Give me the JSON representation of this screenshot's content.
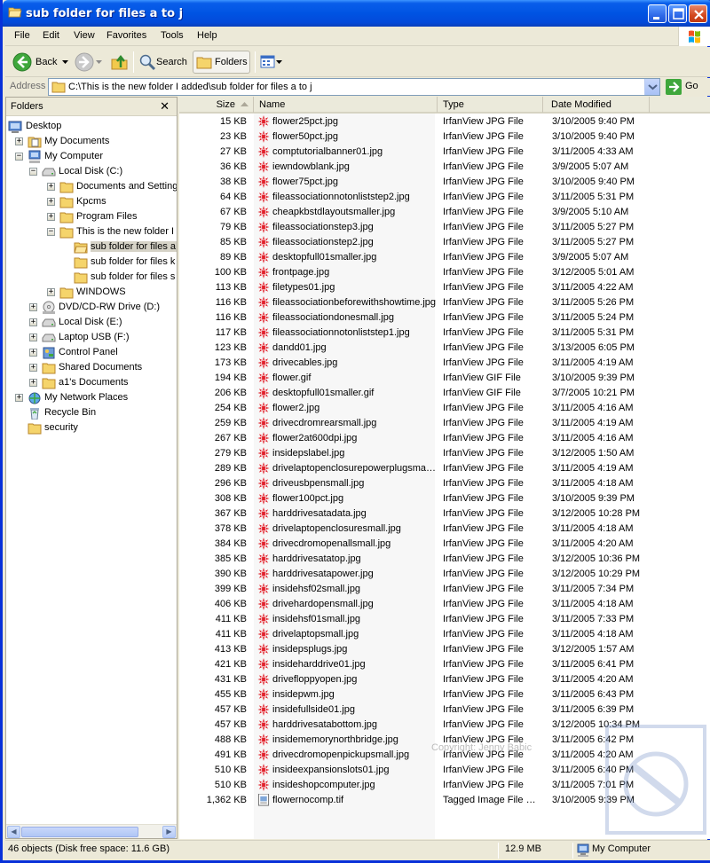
{
  "window": {
    "title": "sub folder for files a to j"
  },
  "menu": [
    {
      "label": "File",
      "u": "F",
      "rest": "ile"
    },
    {
      "label": "Edit",
      "u": "E",
      "rest": "dit"
    },
    {
      "label": "View",
      "u": "V",
      "rest": "iew"
    },
    {
      "label": "Favorites",
      "u": "a",
      "pre": "F",
      "rest": "vorites"
    },
    {
      "label": "Tools",
      "u": "T",
      "rest": "ools"
    },
    {
      "label": "Help",
      "u": "H",
      "rest": "elp"
    }
  ],
  "toolbar": {
    "back": "Back",
    "search": "Search",
    "folders": "Folders"
  },
  "address": {
    "label": "Address",
    "path": "C:\\This is the new folder I added\\sub folder for files a to j",
    "go": "Go"
  },
  "folders_pane": {
    "title": "Folders",
    "tree": [
      {
        "label": "Desktop",
        "level": 0,
        "exp": "",
        "icon": "desktop-icon"
      },
      {
        "label": "My Documents",
        "level": 1,
        "exp": "+",
        "icon": "my-documents-icon"
      },
      {
        "label": "My Computer",
        "level": 1,
        "exp": "−",
        "icon": "my-computer-icon"
      },
      {
        "label": "Local Disk (C:)",
        "level": 2,
        "exp": "−",
        "icon": "local-disk-icon"
      },
      {
        "label": "Documents and Settings",
        "level": 3,
        "exp": "+",
        "icon": "folder-icon"
      },
      {
        "label": "Kpcms",
        "level": 3,
        "exp": "+",
        "icon": "folder-icon"
      },
      {
        "label": "Program Files",
        "level": 3,
        "exp": "+",
        "icon": "folder-icon"
      },
      {
        "label": "This is the new folder I added",
        "level": 3,
        "exp": "−",
        "icon": "folder-icon"
      },
      {
        "label": "sub folder for files a to j",
        "level": 4,
        "exp": "",
        "icon": "open-folder-icon",
        "selected": true
      },
      {
        "label": "sub folder for files k to r",
        "level": 4,
        "exp": "",
        "icon": "folder-icon"
      },
      {
        "label": "sub folder for files s to z",
        "level": 4,
        "exp": "",
        "icon": "folder-icon"
      },
      {
        "label": "WINDOWS",
        "level": 3,
        "exp": "+",
        "icon": "folder-icon"
      },
      {
        "label": "DVD/CD-RW Drive (D:)",
        "level": 2,
        "exp": "+",
        "icon": "cd-drive-icon"
      },
      {
        "label": "Local Disk (E:)",
        "level": 2,
        "exp": "+",
        "icon": "local-disk-icon"
      },
      {
        "label": "Laptop USB (F:)",
        "level": 2,
        "exp": "+",
        "icon": "local-disk-icon"
      },
      {
        "label": "Control Panel",
        "level": 2,
        "exp": "+",
        "icon": "control-panel-icon"
      },
      {
        "label": "Shared Documents",
        "level": 2,
        "exp": "+",
        "icon": "folder-icon"
      },
      {
        "label": "a1's Documents",
        "level": 2,
        "exp": "+",
        "icon": "folder-icon"
      },
      {
        "label": "My Network Places",
        "level": 1,
        "exp": "+",
        "icon": "network-places-icon"
      },
      {
        "label": "Recycle Bin",
        "level": 1,
        "exp": "",
        "icon": "recycle-bin-icon"
      },
      {
        "label": "security",
        "level": 1,
        "exp": "",
        "icon": "folder-icon"
      }
    ]
  },
  "columns": {
    "size": "Size",
    "name": "Name",
    "type": "Type",
    "date": "Date Modified"
  },
  "files": [
    {
      "size": "15 KB",
      "name": "flower25pct.jpg",
      "type": "IrfanView JPG File",
      "date": "3/10/2005 9:40 PM"
    },
    {
      "size": "23 KB",
      "name": "flower50pct.jpg",
      "type": "IrfanView JPG File",
      "date": "3/10/2005 9:40 PM"
    },
    {
      "size": "27 KB",
      "name": "comptutorialbanner01.jpg",
      "type": "IrfanView JPG File",
      "date": "3/11/2005 4:33 AM"
    },
    {
      "size": "36 KB",
      "name": "iewndowblank.jpg",
      "type": "IrfanView JPG File",
      "date": "3/9/2005 5:07 AM"
    },
    {
      "size": "38 KB",
      "name": "flower75pct.jpg",
      "type": "IrfanView JPG File",
      "date": "3/10/2005 9:40 PM"
    },
    {
      "size": "64 KB",
      "name": "fileassociationnotonliststep2.jpg",
      "type": "IrfanView JPG File",
      "date": "3/11/2005 5:31 PM"
    },
    {
      "size": "67 KB",
      "name": "cheapkbstdlayoutsmaller.jpg",
      "type": "IrfanView JPG File",
      "date": "3/9/2005 5:10 AM"
    },
    {
      "size": "79 KB",
      "name": "fileassociationstep3.jpg",
      "type": "IrfanView JPG File",
      "date": "3/11/2005 5:27 PM"
    },
    {
      "size": "85 KB",
      "name": "fileassociationstep2.jpg",
      "type": "IrfanView JPG File",
      "date": "3/11/2005 5:27 PM"
    },
    {
      "size": "89 KB",
      "name": "desktopfull01smaller.jpg",
      "type": "IrfanView JPG File",
      "date": "3/9/2005 5:07 AM"
    },
    {
      "size": "100 KB",
      "name": "frontpage.jpg",
      "type": "IrfanView JPG File",
      "date": "3/12/2005 5:01 AM"
    },
    {
      "size": "113 KB",
      "name": "filetypes01.jpg",
      "type": "IrfanView JPG File",
      "date": "3/11/2005 4:22 AM"
    },
    {
      "size": "116 KB",
      "name": "fileassociationbeforewithshowtime.jpg",
      "type": "IrfanView JPG File",
      "date": "3/11/2005 5:26 PM"
    },
    {
      "size": "116 KB",
      "name": "fileassociationdonesmall.jpg",
      "type": "IrfanView JPG File",
      "date": "3/11/2005 5:24 PM"
    },
    {
      "size": "117 KB",
      "name": "fileassociationnotonliststep1.jpg",
      "type": "IrfanView JPG File",
      "date": "3/11/2005 5:31 PM"
    },
    {
      "size": "123 KB",
      "name": "dandd01.jpg",
      "type": "IrfanView JPG File",
      "date": "3/13/2005 6:05 PM"
    },
    {
      "size": "173 KB",
      "name": "drivecables.jpg",
      "type": "IrfanView JPG File",
      "date": "3/11/2005 4:19 AM"
    },
    {
      "size": "194 KB",
      "name": "flower.gif",
      "type": "IrfanView GIF File",
      "date": "3/10/2005 9:39 PM"
    },
    {
      "size": "206 KB",
      "name": "desktopfull01smaller.gif",
      "type": "IrfanView GIF File",
      "date": "3/7/2005 10:21 PM"
    },
    {
      "size": "254 KB",
      "name": "flower2.jpg",
      "type": "IrfanView JPG File",
      "date": "3/11/2005 4:16 AM"
    },
    {
      "size": "259 KB",
      "name": "drivecdromrearsmall.jpg",
      "type": "IrfanView JPG File",
      "date": "3/11/2005 4:19 AM"
    },
    {
      "size": "267 KB",
      "name": "flower2at600dpi.jpg",
      "type": "IrfanView JPG File",
      "date": "3/11/2005 4:16 AM"
    },
    {
      "size": "279 KB",
      "name": "insidepslabel.jpg",
      "type": "IrfanView JPG File",
      "date": "3/12/2005 1:50 AM"
    },
    {
      "size": "289 KB",
      "name": "drivelaptopenclosurepowerplugsmall.jpg",
      "type": "IrfanView JPG File",
      "date": "3/11/2005 4:19 AM"
    },
    {
      "size": "296 KB",
      "name": "driveusbpensmall.jpg",
      "type": "IrfanView JPG File",
      "date": "3/11/2005 4:18 AM"
    },
    {
      "size": "308 KB",
      "name": "flower100pct.jpg",
      "type": "IrfanView JPG File",
      "date": "3/10/2005 9:39 PM"
    },
    {
      "size": "367 KB",
      "name": "harddrivesatadata.jpg",
      "type": "IrfanView JPG File",
      "date": "3/12/2005 10:28 PM"
    },
    {
      "size": "378 KB",
      "name": "drivelaptopenclosuresmall.jpg",
      "type": "IrfanView JPG File",
      "date": "3/11/2005 4:18 AM"
    },
    {
      "size": "384 KB",
      "name": "drivecdromopenallsmall.jpg",
      "type": "IrfanView JPG File",
      "date": "3/11/2005 4:20 AM"
    },
    {
      "size": "385 KB",
      "name": "harddrivesatatop.jpg",
      "type": "IrfanView JPG File",
      "date": "3/12/2005 10:36 PM"
    },
    {
      "size": "390 KB",
      "name": "harddrivesatapower.jpg",
      "type": "IrfanView JPG File",
      "date": "3/12/2005 10:29 PM"
    },
    {
      "size": "399 KB",
      "name": "insidehsf02small.jpg",
      "type": "IrfanView JPG File",
      "date": "3/11/2005 7:34 PM"
    },
    {
      "size": "406 KB",
      "name": "drivehardopensmall.jpg",
      "type": "IrfanView JPG File",
      "date": "3/11/2005 4:18 AM"
    },
    {
      "size": "411 KB",
      "name": "insidehsf01small.jpg",
      "type": "IrfanView JPG File",
      "date": "3/11/2005 7:33 PM"
    },
    {
      "size": "411 KB",
      "name": "drivelaptopsmall.jpg",
      "type": "IrfanView JPG File",
      "date": "3/11/2005 4:18 AM"
    },
    {
      "size": "413 KB",
      "name": "insidepsplugs.jpg",
      "type": "IrfanView JPG File",
      "date": "3/12/2005 1:57 AM"
    },
    {
      "size": "421 KB",
      "name": "insideharddrive01.jpg",
      "type": "IrfanView JPG File",
      "date": "3/11/2005 6:41 PM"
    },
    {
      "size": "431 KB",
      "name": "drivefloppyopen.jpg",
      "type": "IrfanView JPG File",
      "date": "3/11/2005 4:20 AM"
    },
    {
      "size": "455 KB",
      "name": "insidepwm.jpg",
      "type": "IrfanView JPG File",
      "date": "3/11/2005 6:43 PM"
    },
    {
      "size": "457 KB",
      "name": "insidefullside01.jpg",
      "type": "IrfanView JPG File",
      "date": "3/11/2005 6:39 PM"
    },
    {
      "size": "457 KB",
      "name": "harddrivesatabottom.jpg",
      "type": "IrfanView JPG File",
      "date": "3/12/2005 10:34 PM"
    },
    {
      "size": "488 KB",
      "name": "insidememorynorthbridge.jpg",
      "type": "IrfanView JPG File",
      "date": "3/11/2005 6:42 PM"
    },
    {
      "size": "491 KB",
      "name": "drivecdromopenpickupsmall.jpg",
      "type": "IrfanView JPG File",
      "date": "3/11/2005 4:20 AM"
    },
    {
      "size": "510 KB",
      "name": "insideexpansionslots01.jpg",
      "type": "IrfanView JPG File",
      "date": "3/11/2005 6:40 PM"
    },
    {
      "size": "510 KB",
      "name": "insideshopcomputer.jpg",
      "type": "IrfanView JPG File",
      "date": "3/11/2005 7:01 PM"
    },
    {
      "size": "1,362 KB",
      "name": "flowernocomp.tif",
      "type": "Tagged Image File Format",
      "date": "3/10/2005 9:39 PM",
      "icon": "tif"
    }
  ],
  "watermark": "Copyright: Jenny Babic",
  "status": {
    "objects": "46 objects (Disk free space: 11.6 GB)",
    "size": "12.9 MB",
    "location": "My Computer"
  },
  "colors": {
    "titlebar": "#0054E3",
    "accent": "#316AC5",
    "irfan_red": "#E0202A"
  }
}
